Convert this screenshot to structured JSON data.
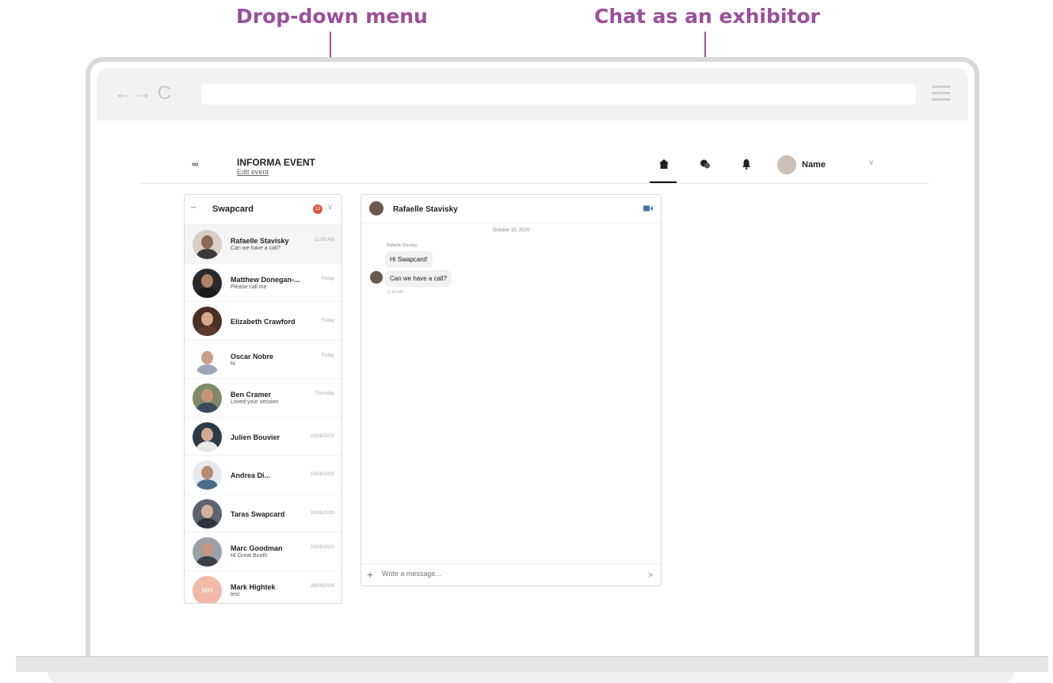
{
  "annotations": {
    "dropdown_label": "Drop-down menu",
    "exhibitor_label": "Chat as an exhibitor"
  },
  "browser": {
    "nav_icons": "←→ C",
    "url": ""
  },
  "header": {
    "logo": "∞",
    "event_title": "INFORMA EVENT",
    "edit_link": "Edit event",
    "user_name": "Name",
    "chevron": "∨"
  },
  "conversations": {
    "panel_title": "Swapcard",
    "panel_logo": "•••",
    "badge_count": "12",
    "chevron": "∨",
    "items": [
      {
        "name": "Rafaelle Stavisky",
        "message": "Can we have a call?",
        "time": "11:00 AM"
      },
      {
        "name": "Matthew Donegan-...",
        "message": "Please call me",
        "time": "Friday"
      },
      {
        "name": "Elizabeth Crawford",
        "message": "",
        "time": "Friday"
      },
      {
        "name": "Oscar Nobre",
        "message": "hi",
        "time": "Friday"
      },
      {
        "name": "Ben Cramer",
        "message": "Loved your session",
        "time": "Thursday"
      },
      {
        "name": "Julien Bouvier",
        "message": "",
        "time": "10/08/2020"
      },
      {
        "name": "Andrea Di...",
        "message": "",
        "time": "10/08/2020"
      },
      {
        "name": "Taras Swapcard",
        "message": "",
        "time": "10/05/2020"
      },
      {
        "name": "Marc Goodman",
        "message": "Hi Great Booth",
        "time": "10/05/2020"
      },
      {
        "name": "Mark Hightek",
        "message": "test",
        "time": "29/09/2020",
        "initials": "MH"
      }
    ]
  },
  "chat": {
    "contact_name": "Rafaelle Stavisky",
    "date": "October 15, 2020",
    "sender": "Rafaelle Stavisky",
    "messages": [
      "Hi Swapcard!",
      "Can we have a call?"
    ],
    "message_time": "11:00 AM",
    "input_placeholder": "Write a message...",
    "plus": "+",
    "send": "➤"
  },
  "colors": {
    "annotation": "#9b4f9b",
    "badge": "#e0563c"
  }
}
